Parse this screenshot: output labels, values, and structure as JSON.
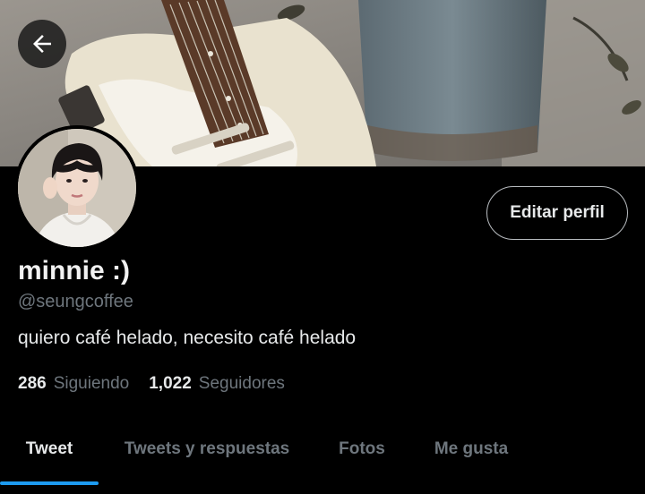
{
  "profile": {
    "name": "minnie :)",
    "handle": "@seungcoffee",
    "bio": "quiero café helado, necesito café helado"
  },
  "actions": {
    "edit_profile": "Editar perfil"
  },
  "stats": {
    "following_count": "286",
    "following_label": "Siguiendo",
    "followers_count": "1,022",
    "followers_label": "Seguidores"
  },
  "tabs": [
    {
      "label": "Tweet",
      "active": true
    },
    {
      "label": "Tweets y respuestas",
      "active": false
    },
    {
      "label": "Fotos",
      "active": false
    },
    {
      "label": "Me gusta",
      "active": false
    }
  ],
  "icons": {
    "back": "arrow-left-icon"
  },
  "colors": {
    "background": "#000000",
    "accent": "#1d9bf0",
    "secondary_text": "#6e767d"
  }
}
